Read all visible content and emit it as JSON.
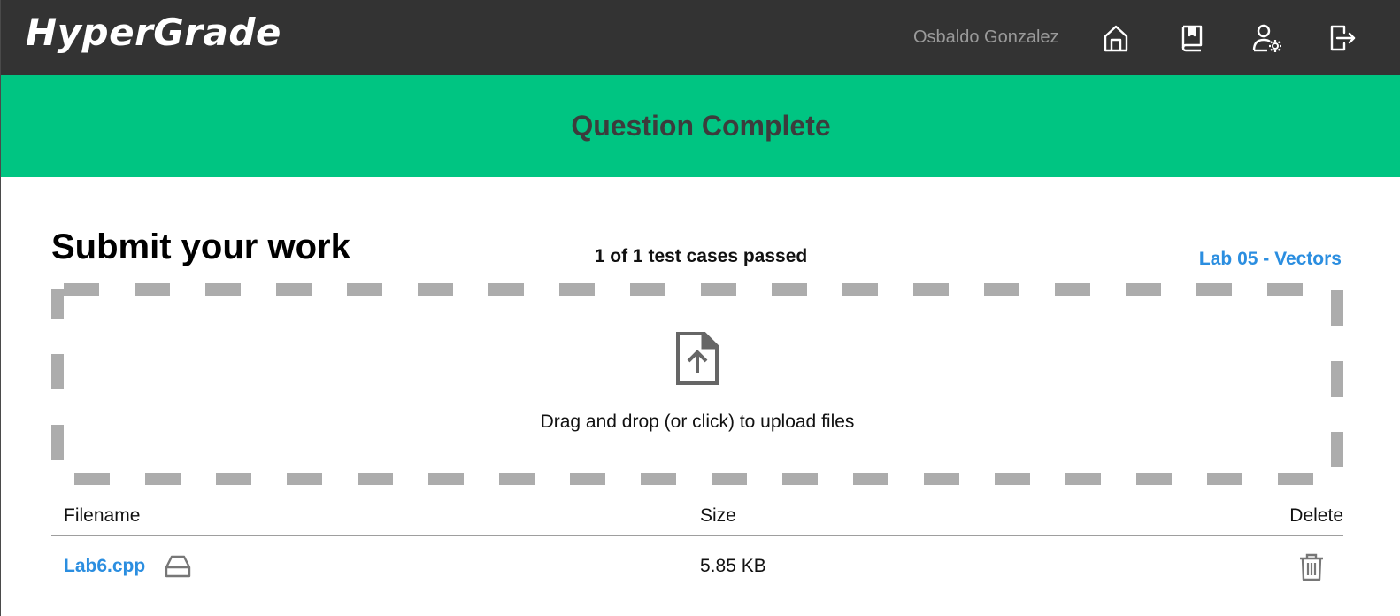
{
  "header": {
    "logo": "HyperGrade",
    "username": "Osbaldo Gonzalez",
    "nav_icons": [
      "home-icon",
      "book-icon",
      "user-settings-icon",
      "logout-icon"
    ]
  },
  "banner": {
    "text": "Question Complete",
    "color": "#00c582"
  },
  "main": {
    "title": "Submit your work",
    "test_status": "1 of 1 test cases passed",
    "lab_link": "Lab 05 - Vectors"
  },
  "dropzone": {
    "text": "Drag and drop (or click) to upload files",
    "icon": "file-upload-icon"
  },
  "files_table": {
    "columns": [
      "Filename",
      "Size",
      "Delete"
    ],
    "rows": [
      {
        "filename": "Lab6.cpp",
        "size": "5.85 KB",
        "icon": "drive-icon",
        "delete_icon": "trash-icon"
      }
    ]
  },
  "colors": {
    "topbar": "#333333",
    "link": "#2b8ee0",
    "dash": "#acacac"
  }
}
